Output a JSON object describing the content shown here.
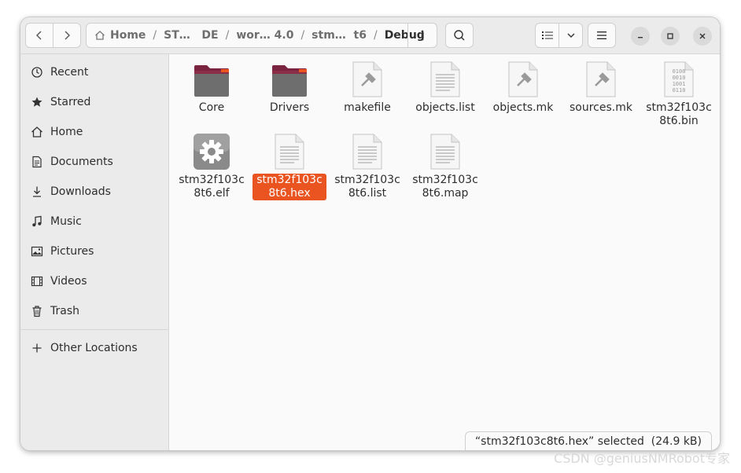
{
  "header": {
    "path": [
      {
        "label": "Home"
      },
      {
        "label": "ST…   DE"
      },
      {
        "label": "wor… 4.0"
      },
      {
        "label": "stm…  t6"
      },
      {
        "label": "Debug"
      }
    ],
    "back_icon": "chevron-left-icon",
    "forward_icon": "chevron-right-icon",
    "home_icon": "home-icon",
    "search_icon": "search-icon",
    "list_view_icon": "list-view-icon",
    "view_options_icon": "chevron-down-icon",
    "menu_icon": "hamburger-menu-icon"
  },
  "sidebar": {
    "items": [
      {
        "label": "Recent",
        "icon": "clock-icon"
      },
      {
        "label": "Starred",
        "icon": "star-icon"
      },
      {
        "label": "Home",
        "icon": "home-icon"
      },
      {
        "label": "Documents",
        "icon": "document-icon"
      },
      {
        "label": "Downloads",
        "icon": "download-icon"
      },
      {
        "label": "Music",
        "icon": "music-note-icon"
      },
      {
        "label": "Pictures",
        "icon": "picture-icon"
      },
      {
        "label": "Videos",
        "icon": "film-icon"
      },
      {
        "label": "Trash",
        "icon": "trash-icon"
      }
    ],
    "other": {
      "label": "Other Locations",
      "icon": "plus-icon"
    }
  },
  "files": [
    {
      "name": "Core",
      "icon": "folder-icon",
      "selected": false
    },
    {
      "name": "Drivers",
      "icon": "folder-icon",
      "selected": false
    },
    {
      "name": "makefile",
      "icon": "script-file-icon",
      "selected": false
    },
    {
      "name": "objects.list",
      "icon": "text-file-icon",
      "selected": false
    },
    {
      "name": "objects.mk",
      "icon": "script-file-icon",
      "selected": false
    },
    {
      "name": "sources.mk",
      "icon": "script-file-icon",
      "selected": false
    },
    {
      "name": "stm32f103c8t6.bin",
      "icon": "binary-file-icon",
      "selected": false
    },
    {
      "name": "stm32f103c8t6.elf",
      "icon": "executable-gear-icon",
      "selected": false
    },
    {
      "name": "stm32f103c8t6.hex",
      "icon": "text-file-icon",
      "selected": true
    },
    {
      "name": "stm32f103c8t6.list",
      "icon": "text-file-icon",
      "selected": false
    },
    {
      "name": "stm32f103c8t6.map",
      "icon": "text-file-icon",
      "selected": false
    }
  ],
  "status": {
    "text": "“stm32f103c8t6.hex” selected  (24.9 kB)"
  },
  "watermark": "CSDN @geniusNMRobot专家",
  "colors": {
    "accent": "#e95420",
    "folder": "#8a2f47"
  }
}
